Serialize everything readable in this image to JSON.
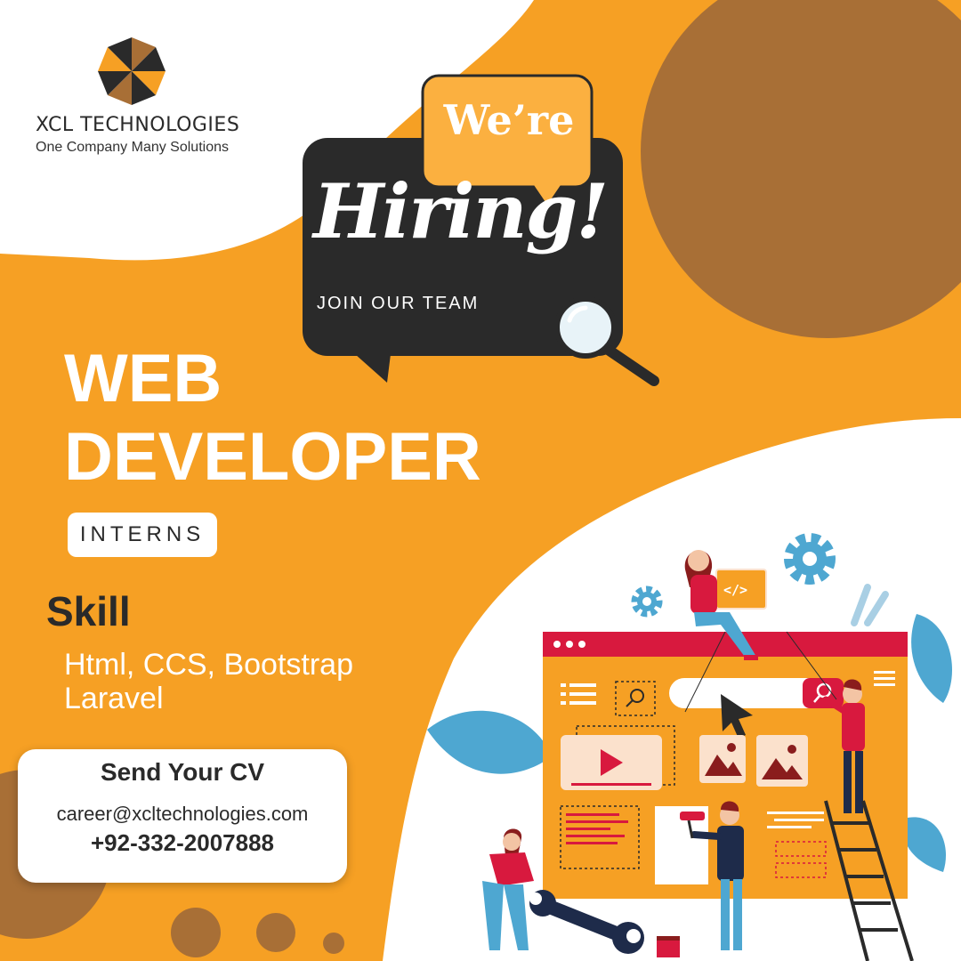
{
  "brand": {
    "name": "XCL TECHNOLOGIES",
    "tagline": "One Company Many Solutions"
  },
  "headline": {
    "were": "We’re",
    "hiring": "Hiring!",
    "subline": "JOIN OUR TEAM"
  },
  "job": {
    "title_line1": "WEB",
    "title_line2": "DEVELOPER",
    "badge": "INTERNS"
  },
  "skills": {
    "heading": "Skill",
    "line1": "Html, CCS, Bootstrap",
    "line2": "Laravel"
  },
  "contact": {
    "title": "Send Your CV",
    "email": "career@xcltechnologies.com",
    "phone": "+92-332-2007888"
  },
  "illustration": {
    "code_tag": "</>"
  },
  "colors": {
    "orange": "#f6a024",
    "brown": "#a86f36",
    "dark": "#2a2a2a",
    "crimson": "#d8193e",
    "blue": "#4ea7d1"
  },
  "icons": [
    "umbrella-logo-icon",
    "magnifier-icon",
    "gear-icon",
    "play-icon",
    "image-icon",
    "cursor-icon",
    "wrench-icon"
  ]
}
